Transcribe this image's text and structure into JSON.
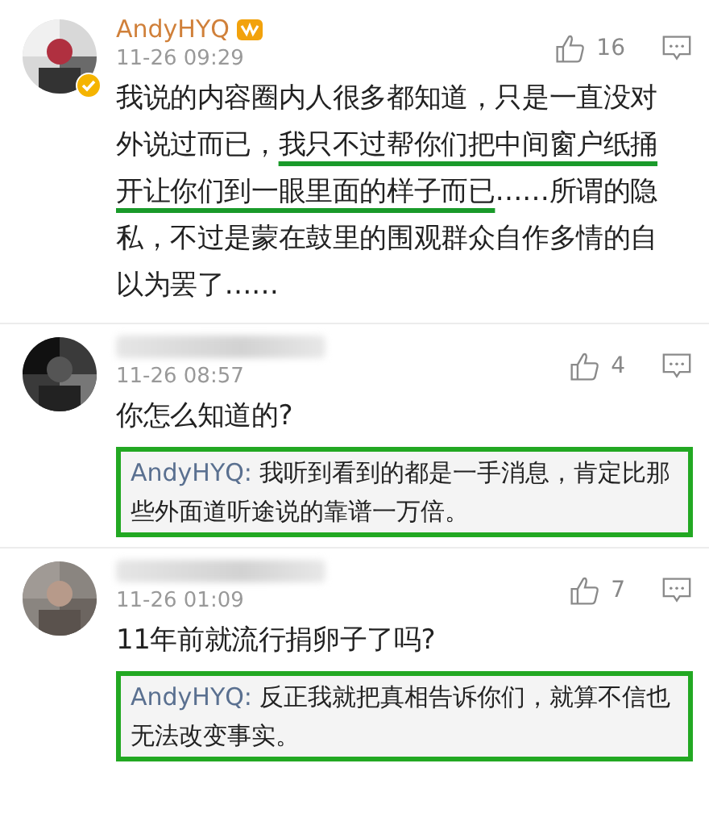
{
  "comments": [
    {
      "author": {
        "kind": "text",
        "name": "AndyHYQ"
      },
      "verified": true,
      "vip_badge": true,
      "time": "11-26 09:29",
      "likes": "16",
      "body": [
        {
          "text": "我说的内容圈内人很多都知道，只是一直没对外说过而已，",
          "underlined": false
        },
        {
          "text": "我只不过帮你们把中间窗户纸捅开让你们到一眼里面的样子而已",
          "underlined": true
        },
        {
          "text": "……所谓的隐私，不过是蒙在鼓里的围观群众自作多情的自以为罢了……",
          "underlined": false
        }
      ]
    },
    {
      "author": {
        "kind": "blurred"
      },
      "verified": false,
      "vip_badge": false,
      "time": "11-26 08:57",
      "likes": "4",
      "body": [
        {
          "text": "你怎么知道的?",
          "underlined": false
        }
      ],
      "reply": {
        "author": "AndyHYQ:",
        "text": "我听到看到的都是一手消息，肯定比那些外面道听途说的靠谱一万倍。",
        "highlighted": true
      }
    },
    {
      "author": {
        "kind": "blurred"
      },
      "verified": false,
      "vip_badge": false,
      "time": "11-26 01:09",
      "likes": "7",
      "body": [
        {
          "text": "11年前就流行捐卵子了吗?",
          "underlined": false
        }
      ],
      "reply": {
        "author": "AndyHYQ:",
        "text": "反正我就把真相告诉你们，就算不信也无法改变事实。",
        "highlighted": true
      }
    }
  ]
}
